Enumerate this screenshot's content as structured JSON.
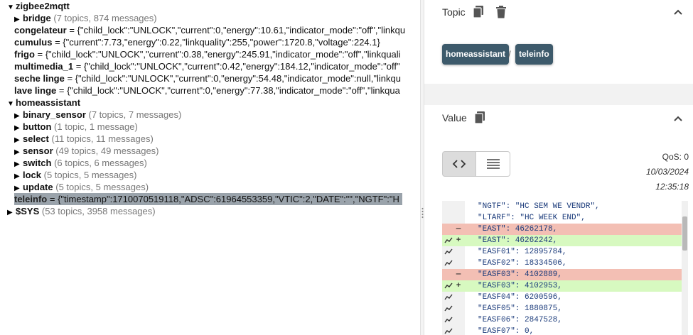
{
  "tree": {
    "nodes": [
      {
        "name": "zigbee2mqtt",
        "stats": "",
        "value": "",
        "expanded": true,
        "level": 0
      },
      {
        "name": "bridge",
        "stats": "(7 topics, 874 messages)",
        "value": "",
        "expanded": false,
        "level": 1
      },
      {
        "name": "congelateur",
        "stats": "",
        "value": "= {\"child_lock\":\"UNLOCK\",\"current\":0,\"energy\":10.61,\"indicator_mode\":\"off\",\"linkqu",
        "level": 1
      },
      {
        "name": "cumulus",
        "stats": "",
        "value": "= {\"current\":7.73,\"energy\":0.22,\"linkquality\":255,\"power\":1720.8,\"voltage\":224.1}",
        "level": 1
      },
      {
        "name": "frigo",
        "stats": "",
        "value": "= {\"child_lock\":\"UNLOCK\",\"current\":0.38,\"energy\":245.91,\"indicator_mode\":\"off\",\"linkquali",
        "level": 1
      },
      {
        "name": "multimedia_1",
        "stats": "",
        "value": "= {\"child_lock\":\"UNLOCK\",\"current\":0.42,\"energy\":184.12,\"indicator_mode\":\"off\"",
        "level": 1
      },
      {
        "name": "seche linge",
        "stats": "",
        "value": "= {\"child_lock\":\"UNLOCK\",\"current\":0,\"energy\":54.48,\"indicator_mode\":null,\"linkqu",
        "level": 1
      },
      {
        "name": "lave linge",
        "stats": "",
        "value": "= {\"child_lock\":\"UNLOCK\",\"current\":0,\"energy\":77.38,\"indicator_mode\":\"off\",\"linkqua",
        "level": 1
      },
      {
        "name": "homeassistant",
        "stats": "",
        "value": "",
        "expanded": true,
        "level": 0
      },
      {
        "name": "binary_sensor",
        "stats": "(7 topics, 7 messages)",
        "value": "",
        "expanded": false,
        "level": 1
      },
      {
        "name": "button",
        "stats": "(1 topic, 1 message)",
        "value": "",
        "expanded": false,
        "level": 1
      },
      {
        "name": "select",
        "stats": "(11 topics, 11 messages)",
        "value": "",
        "expanded": false,
        "level": 1
      },
      {
        "name": "sensor",
        "stats": "(49 topics, 49 messages)",
        "value": "",
        "expanded": false,
        "level": 1
      },
      {
        "name": "switch",
        "stats": "(6 topics, 6 messages)",
        "value": "",
        "expanded": false,
        "level": 1
      },
      {
        "name": "lock",
        "stats": "(5 topics, 5 messages)",
        "value": "",
        "expanded": false,
        "level": 1
      },
      {
        "name": "update",
        "stats": "(5 topics, 5 messages)",
        "value": "",
        "expanded": false,
        "level": 1
      },
      {
        "name": "teleinfo",
        "stats": "",
        "value": "= {\"timestamp\":1710070519118,\"ADSC\":61964553359,\"VTIC\":2,\"DATE\":\"\",\"NGTF\":\"H",
        "level": 1,
        "selected": true
      },
      {
        "name": "$SYS",
        "stats": "(53 topics, 3958 messages)",
        "value": "",
        "expanded": false,
        "level": 0
      }
    ]
  },
  "topic_panel": {
    "title": "Topic",
    "breadcrumb": [
      "homeassistant",
      "teleinfo"
    ],
    "separator": "/"
  },
  "value_panel": {
    "title": "Value",
    "qos": "QoS: 0",
    "date": "10/03/2024",
    "time": "12:35:18",
    "diff": [
      {
        "type": "context",
        "trend": false,
        "text": "\"NGTF\": \"HC SEM WE VENDR\","
      },
      {
        "type": "context",
        "trend": false,
        "text": "\"LTARF\": \"HC WEEK END\","
      },
      {
        "type": "removed",
        "trend": false,
        "text": "\"EAST\": 46262178,"
      },
      {
        "type": "added",
        "trend": true,
        "text": "\"EAST\": 46262242,"
      },
      {
        "type": "context",
        "trend": true,
        "text": "\"EASF01\": 12895784,"
      },
      {
        "type": "context",
        "trend": true,
        "text": "\"EASF02\": 18334506,"
      },
      {
        "type": "removed",
        "trend": false,
        "text": "\"EASF03\": 4102889,"
      },
      {
        "type": "added",
        "trend": true,
        "text": "\"EASF03\": 4102953,"
      },
      {
        "type": "context",
        "trend": true,
        "text": "\"EASF04\": 6200596,"
      },
      {
        "type": "context",
        "trend": true,
        "text": "\"EASF05\": 1880875,"
      },
      {
        "type": "context",
        "trend": true,
        "text": "\"EASF06\": 2847528,"
      },
      {
        "type": "context",
        "trend": true,
        "text": "\"EASF07\": 0,"
      }
    ]
  },
  "colors": {
    "chip_bg": "#3d5a6b",
    "removed_bg": "#f3bfb4",
    "added_bg": "#d7f9c0",
    "selected_bg": "#9aa3ab"
  }
}
